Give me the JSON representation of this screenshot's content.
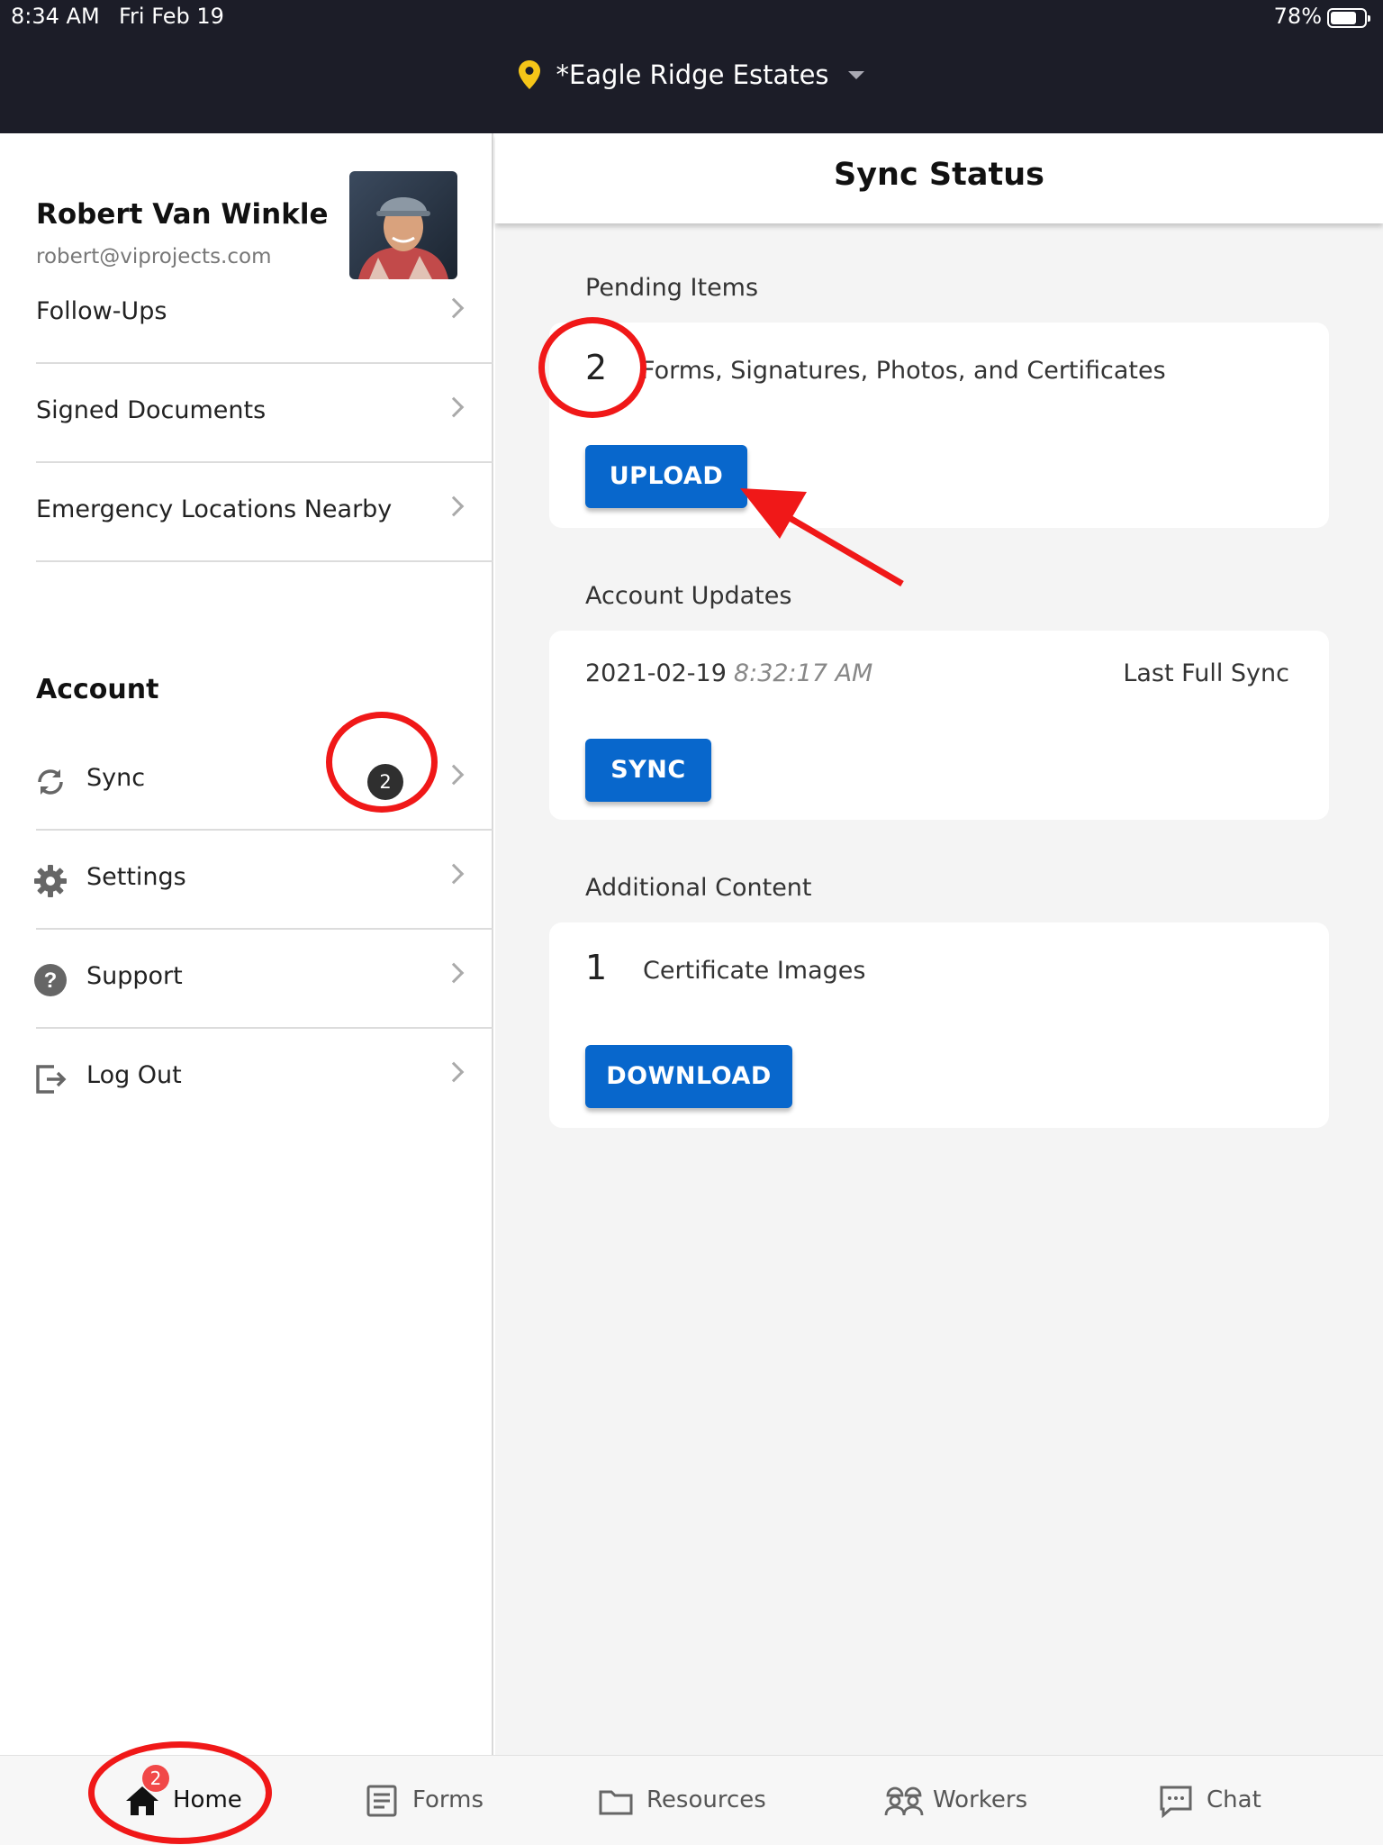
{
  "status_bar": {
    "time": "8:34 AM",
    "date": "Fri Feb 19",
    "battery": "78%",
    "battery_level": 0.78
  },
  "header": {
    "location": "*Eagle Ridge Estates"
  },
  "profile": {
    "name": "Robert Van Winkle",
    "email": "robert@viprojects.com"
  },
  "sidebar": {
    "items": [
      {
        "label": "Follow-Ups"
      },
      {
        "label": "Signed Documents"
      },
      {
        "label": "Emergency Locations Nearby"
      }
    ],
    "account_title": "Account",
    "account_items": [
      {
        "label": "Sync",
        "badge": "2",
        "icon": "sync-icon"
      },
      {
        "label": "Settings",
        "icon": "gear-icon"
      },
      {
        "label": "Support",
        "icon": "help-icon"
      },
      {
        "label": "Log Out",
        "icon": "logout-icon"
      }
    ]
  },
  "main": {
    "title": "Sync Status",
    "pending": {
      "section_label": "Pending Items",
      "count": "2",
      "description": "Forms, Signatures, Photos, and Certificates",
      "button": "UPLOAD"
    },
    "updates": {
      "section_label": "Account Updates",
      "date": "2021-02-19",
      "time": "8:32:17 AM",
      "status": "Last Full Sync",
      "button": "SYNC"
    },
    "additional": {
      "section_label": "Additional Content",
      "count": "1",
      "description": "Certificate Images",
      "button": "DOWNLOAD"
    }
  },
  "tabbar": {
    "tabs": [
      {
        "label": "Home",
        "icon": "home-icon",
        "badge": "2",
        "active": true
      },
      {
        "label": "Forms",
        "icon": "document-icon"
      },
      {
        "label": "Resources",
        "icon": "folder-icon"
      },
      {
        "label": "Workers",
        "icon": "workers-icon"
      },
      {
        "label": "Chat",
        "icon": "chat-icon"
      }
    ]
  },
  "colors": {
    "accent": "#0867cc",
    "annotation": "#f01818",
    "topbar": "#1c1d28",
    "badge": "#f14848",
    "pin": "#f5c518"
  }
}
